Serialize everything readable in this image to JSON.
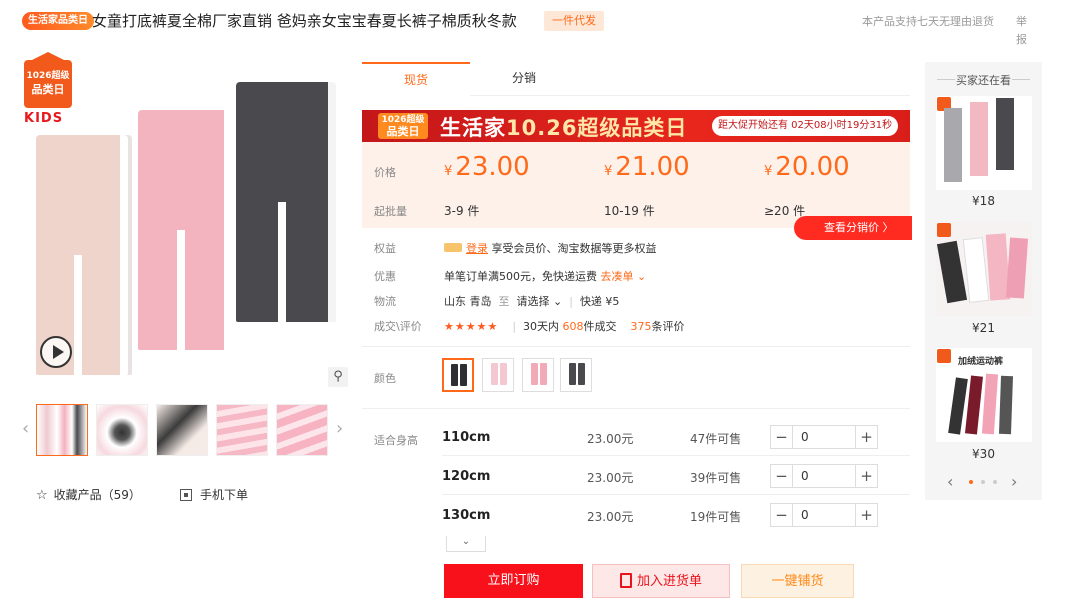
{
  "title_bar": {
    "promo_tag": "生活家品类日",
    "product_title": "女童打底裤夏全棉厂家直销 爸妈亲女宝宝春夏长裤子棉质秋冬款",
    "dropship_tag": "一件代发",
    "return_notice": "本产品支持七天无理由退货",
    "report_link": "举报"
  },
  "gallery": {
    "brand_badge_line1": "1026超级",
    "brand_badge_line2": "品类日",
    "brand_kids": "KIDS",
    "thumb_prev": "‹",
    "thumb_next": "›",
    "collect_label": "收藏产品（59）",
    "mobile_order_label": "手机下单",
    "zoom_glyph": "⚲"
  },
  "tabs": [
    {
      "label": "现货",
      "active": true
    },
    {
      "label": "分销",
      "active": false
    }
  ],
  "banner": {
    "badge_line1": "1026超级",
    "badge_line2": "品类日",
    "title_part1": "生活家",
    "title_part2": "10.26超级品类日",
    "countdown": "距大促开始还有 02天08小时19分31秒"
  },
  "pricing": {
    "price_label": "价格",
    "batch_label": "起批量",
    "currency": "¥",
    "tiers": [
      {
        "price": "23.00",
        "batch": "3-9 件"
      },
      {
        "price": "21.00",
        "batch": "10-19 件"
      },
      {
        "price": "20.00",
        "batch": "≥20 件"
      }
    ],
    "view_distribution_price": "查看分销价 〉"
  },
  "info": {
    "rights_label": "权益",
    "rights_link": "登录",
    "rights_text": "享受会员价、淘宝数据等更多权益",
    "discount_label": "优惠",
    "discount_text": "单笔订单满500元，免快递运费",
    "discount_link": "去凑单 ⌄",
    "logistics_label": "物流",
    "logistics_from": "山东 青岛",
    "logistics_to_word": "至",
    "logistics_select": "请选择 ⌄",
    "logistics_fee": "快递 ¥5",
    "deal_label": "成交\\评价",
    "stars": "★★★★★",
    "deal_prefix": "30天内",
    "deal_count": "608",
    "deal_suffix": "件成交",
    "review_count": "375",
    "review_suffix": "条评价"
  },
  "colors": {
    "label": "颜色",
    "swatches": [
      {
        "name": "黑色",
        "hex": "#2f2f33",
        "selected": true
      },
      {
        "name": "浅粉",
        "hex": "#f3c8d0",
        "selected": false
      },
      {
        "name": "粉色",
        "hex": "#f2a9b8",
        "selected": false
      },
      {
        "name": "深灰",
        "hex": "#4a4a4e",
        "selected": false
      }
    ]
  },
  "sizes": {
    "label": "适合身高",
    "rows": [
      {
        "size": "110cm",
        "price": "23.00元",
        "stock": "47件可售",
        "qty": "0"
      },
      {
        "size": "120cm",
        "price": "23.00元",
        "stock": "39件可售",
        "qty": "0"
      },
      {
        "size": "130cm",
        "price": "23.00元",
        "stock": "19件可售",
        "qty": "0"
      }
    ],
    "minus": "−",
    "plus": "+",
    "expand": "⌄"
  },
  "actions": {
    "order_now": "立即订购",
    "add_to_cart": "加入进货单",
    "one_key": "一键铺货"
  },
  "right_panel": {
    "title": "买家还在看",
    "items": [
      {
        "price": "¥18"
      },
      {
        "price": "¥21"
      },
      {
        "price": "¥30",
        "image_text": "加绒运动裤"
      }
    ],
    "prev": "‹",
    "next": "›"
  },
  "colors_theme": {
    "accent": "#ff6a1a",
    "brand_red": "#f8101b"
  }
}
